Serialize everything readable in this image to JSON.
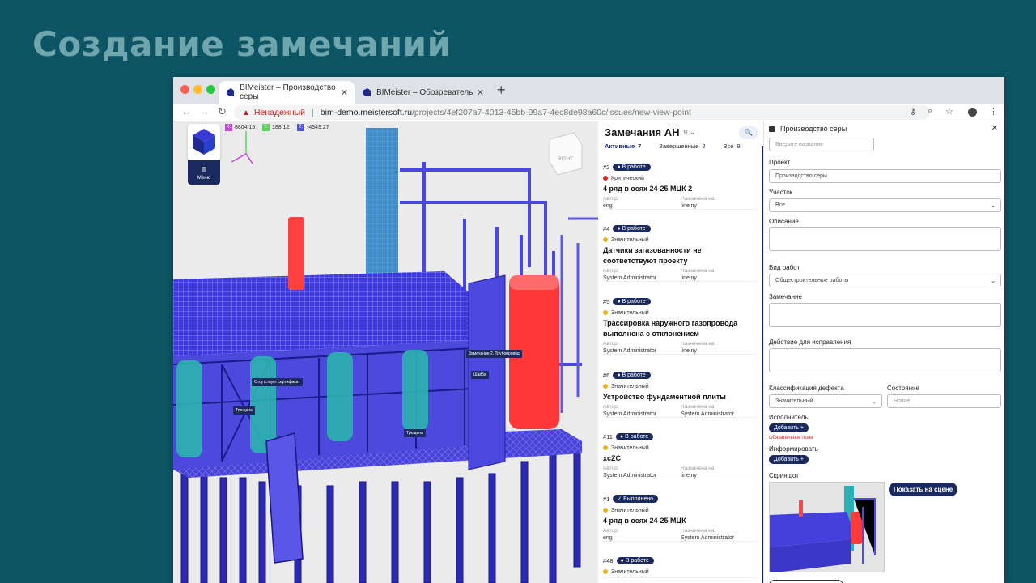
{
  "slide": {
    "title": "Создание замечаний"
  },
  "browser": {
    "tabs": [
      {
        "label": "BIMeister – Производство серы",
        "active": true
      },
      {
        "label": "BIMeister – Обозреватель",
        "active": false
      }
    ],
    "new_tab": "+",
    "security_label": "Ненадежный",
    "url_host": "bim-demo.meistersoft.ru",
    "url_path": "/projects/4ef207a7-4013-45bb-99a7-4ec8de98a60c/issues/new-view-point"
  },
  "viewer": {
    "coords": [
      {
        "axis": "X:",
        "value": "8804.15",
        "color": "#c14ad8"
      },
      {
        "axis": "Y:",
        "value": "188.12",
        "color": "#5bd25b"
      },
      {
        "axis": "Z:",
        "value": "-4349.27",
        "color": "#4c54d9"
      }
    ],
    "menu_label": "Меню",
    "cube_label": "RIGHT",
    "markers": [
      {
        "text": "Отсутствует сертификат"
      },
      {
        "text": "Трещина"
      },
      {
        "text": "Трещина"
      },
      {
        "text": "Замечание 2. Трубопровод"
      },
      {
        "text": "Шайба"
      }
    ]
  },
  "issues": {
    "title": "Замечания АН",
    "count": "9",
    "filters": [
      {
        "label": "Активные",
        "count": "7",
        "active": true
      },
      {
        "label": "Завершенные",
        "count": "2",
        "active": false
      },
      {
        "label": "Все",
        "count": "9",
        "active": false
      }
    ],
    "author_label": "Автор:",
    "assignee_label": "Назначена на:",
    "items": [
      {
        "num": "#2",
        "status": "В работе",
        "priority": "Критический",
        "priority_color": "#d62828",
        "title": "4 ряд в осях 24-25 МЦК 2",
        "author": "eng",
        "assignee": "lineiny"
      },
      {
        "num": "#4",
        "status": "В работе",
        "priority": "Значительный",
        "priority_color": "#e6b422",
        "title": "Датчики загазованности не соответствуют проекту",
        "author": "System Administrator",
        "assignee": "lineiny"
      },
      {
        "num": "#5",
        "status": "В работе",
        "priority": "Значительный",
        "priority_color": "#e6b422",
        "title": "Трассировка наружного газопровода выполнена с отклонением",
        "author": "System Administrator",
        "assignee": "lineiny"
      },
      {
        "num": "#6",
        "status": "В работе",
        "priority": "Значительный",
        "priority_color": "#e6b422",
        "title": "Устройство фундаментной плиты",
        "author": "System Administrator",
        "assignee": "System Administrator"
      },
      {
        "num": "#11",
        "status": "В работе",
        "priority": "Значительный",
        "priority_color": "#e6b422",
        "title": "xcZC",
        "author": "System Administrator",
        "assignee": "lineiny"
      },
      {
        "num": "#1",
        "status": "Выполнено",
        "priority": "Значительный",
        "priority_color": "#e6b422",
        "title": "4 ряд в осях 24-25 МЦК",
        "author": "eng",
        "assignee": "System Administrator"
      },
      {
        "num": "#48",
        "status": "В работе",
        "priority": "Значительный",
        "priority_color": "#e6b422",
        "title": "",
        "author": "",
        "assignee": ""
      }
    ]
  },
  "form": {
    "header": "Производство серы",
    "name_placeholder": "Введите название",
    "project_label": "Проект",
    "project_value": "Производство серы",
    "area_label": "Участок",
    "area_value": "Все",
    "description_label": "Описание",
    "work_type_label": "Вид работ",
    "work_type_value": "Общестроительные работы",
    "remark_label": "Замечание",
    "fix_label": "Действие для исправления",
    "defect_label": "Классификация дефекта",
    "defect_value": "Значительный",
    "state_label": "Состояние",
    "state_value": "Новое",
    "executor_label": "Исполнитель",
    "add_label": "Добавить +",
    "required_text": "Обязательное поле",
    "inform_label": "Информировать",
    "screenshot_label": "Скриншот",
    "show_on_scene": "Показать на сцене"
  },
  "colors": {
    "accent": "#1b2a5e",
    "model_blue": "#3d3ae0",
    "model_red": "#ff3b3b",
    "model_teal": "#2fb3b8"
  }
}
